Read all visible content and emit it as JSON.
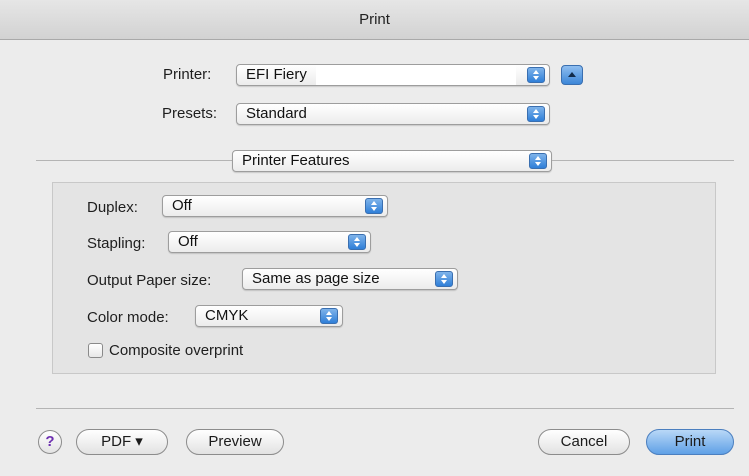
{
  "window": {
    "title": "Print"
  },
  "printer": {
    "label": "Printer:",
    "value": "EFI Fiery"
  },
  "presets": {
    "label": "Presets:",
    "value": "Standard"
  },
  "section": {
    "value": "Printer Features"
  },
  "features": {
    "duplex": {
      "label": "Duplex:",
      "value": "Off"
    },
    "stapling": {
      "label": "Stapling:",
      "value": "Off"
    },
    "output_paper_size": {
      "label": "Output Paper size:",
      "value": "Same as page size"
    },
    "color_mode": {
      "label": "Color mode:",
      "value": "CMYK"
    },
    "composite_overprint": {
      "label": "Composite overprint",
      "checked": false
    }
  },
  "footer": {
    "help_label": "?",
    "pdf_label": "PDF ▾",
    "preview_label": "Preview",
    "cancel_label": "Cancel",
    "print_label": "Print"
  },
  "icons": {
    "stepper": "up-down-arrows-icon",
    "disclosure": "triangle-up-icon",
    "help": "question-mark-icon"
  },
  "colors": {
    "accent": "#3c86d8",
    "default_button": "#5fa0e6",
    "help_glyph": "#6d2fb0"
  }
}
